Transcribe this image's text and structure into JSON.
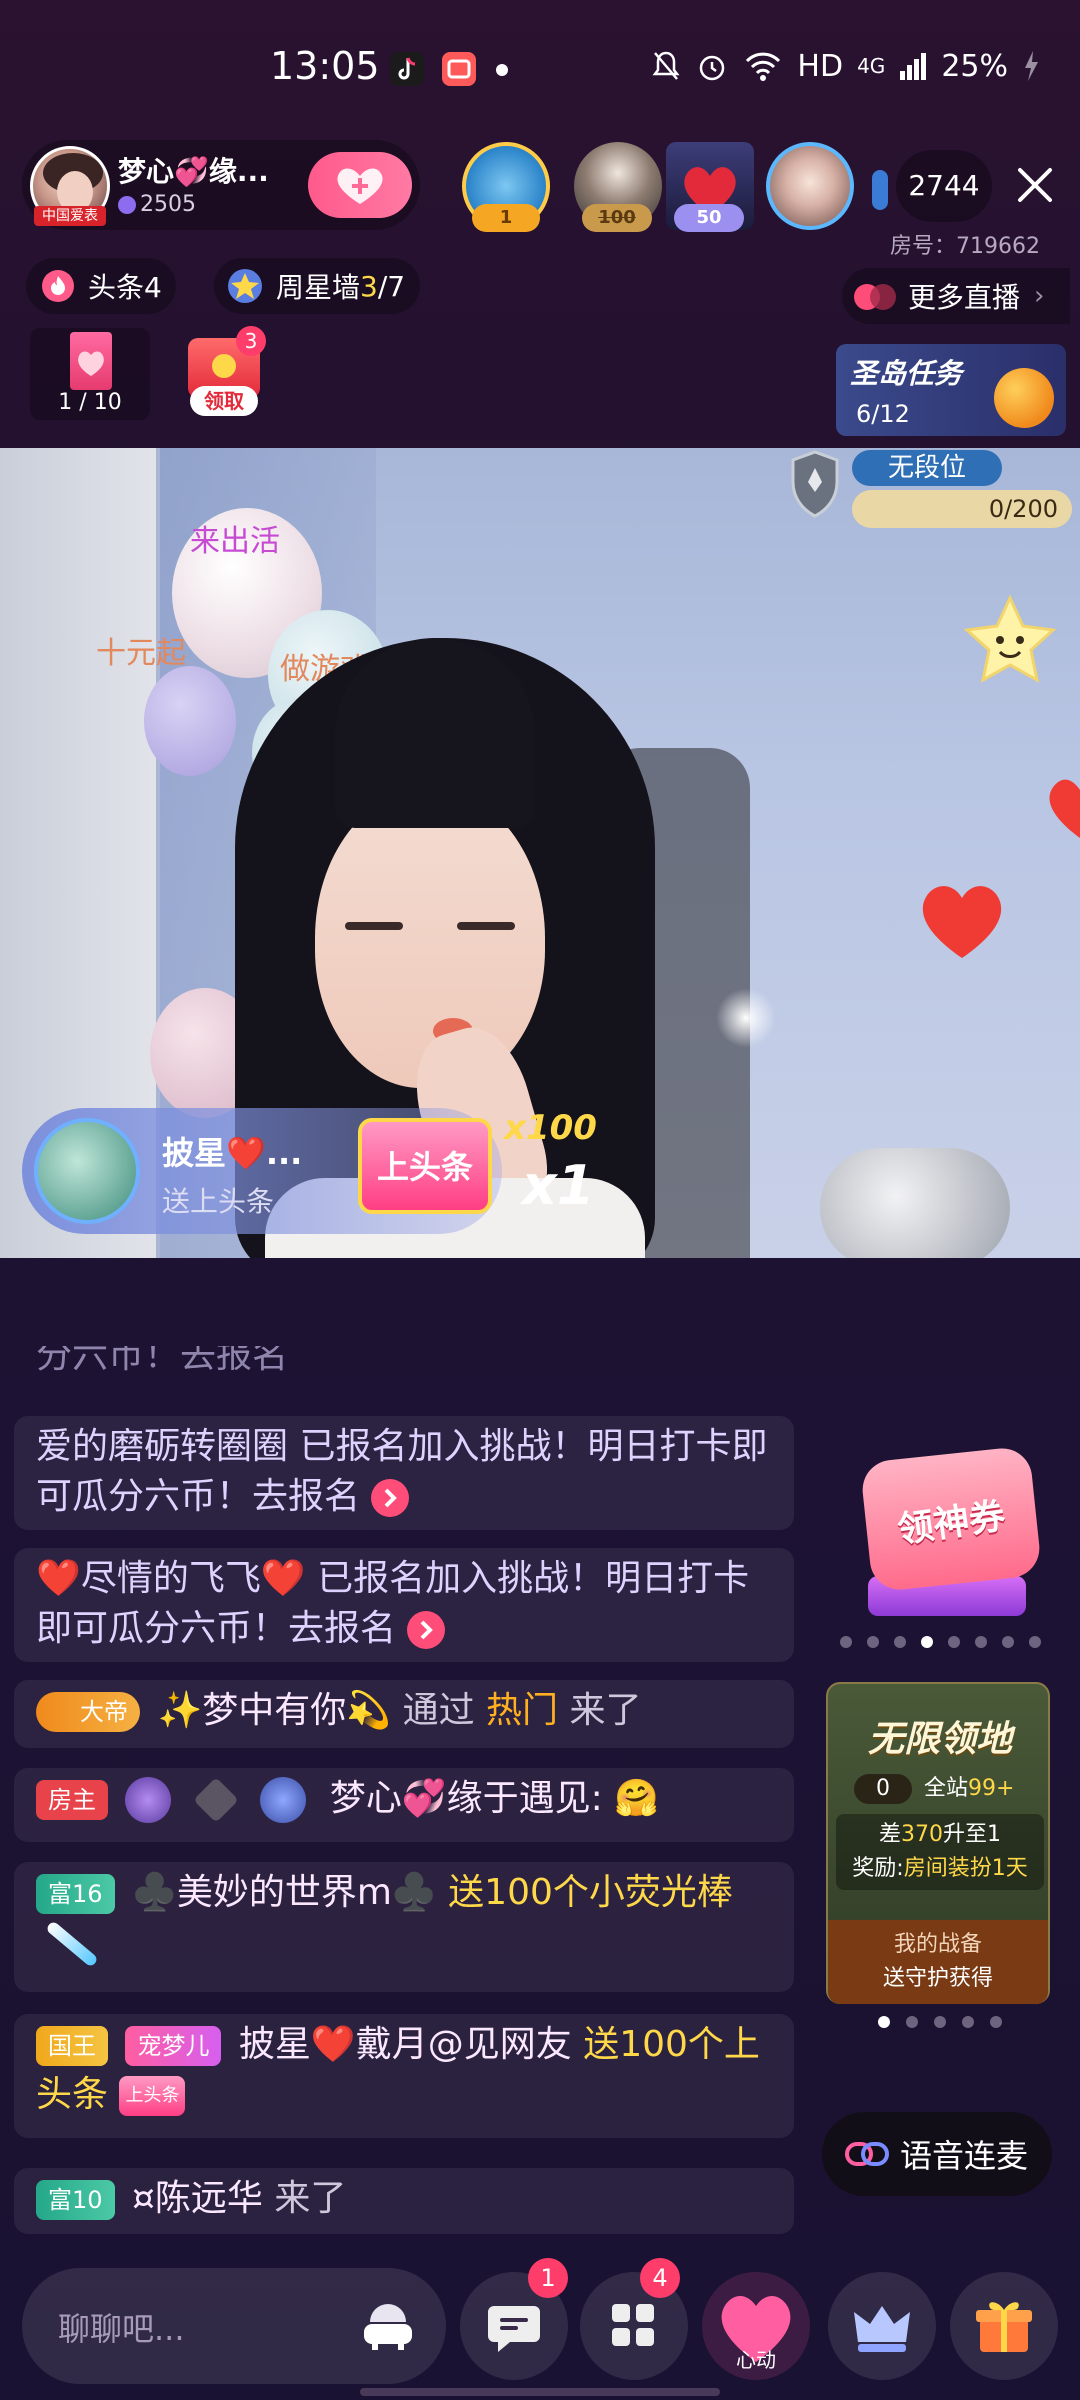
{
  "status": {
    "time": "13:05",
    "network": "HD",
    "signal": "4G",
    "battery": "25%"
  },
  "anchor": {
    "name": "梦心💞缘...",
    "avatar_tag": "中国爱表",
    "count": "2505"
  },
  "viewers": [
    {
      "badge": "1"
    },
    {
      "badge": "100"
    },
    {
      "badge": "50"
    },
    {
      "badge": ""
    }
  ],
  "viewer_count": "2744",
  "room_no": "房号：719662",
  "toutiao_label": "头条4",
  "star_wall": {
    "prefix": "周星墙",
    "current": "3",
    "total": "/7"
  },
  "more_live": "更多直播",
  "card_progress": "1 / 10",
  "redpack": {
    "label": "领取",
    "badge": "3"
  },
  "task": {
    "title": "圣岛任务",
    "progress": "6/12"
  },
  "rank": {
    "title": "无段位",
    "progress": "0/200"
  },
  "balloon_texts": [
    "来出活",
    "十元起",
    "做游戏"
  ],
  "gift_banner": {
    "name": "披星❤️...",
    "sub": "送上头条",
    "gift": "上头条",
    "count": "x100",
    "multiplier": "x1"
  },
  "chat": {
    "partial": "分六币！去报名",
    "rows": [
      {
        "text": "爱的磨砺转圈圈 已报名加入挑战！明日打卡即可瓜分六币！去报名"
      },
      {
        "text": "❤️尽情的飞飞❤️ 已报名加入挑战！明日打卡即可瓜分六币！去报名"
      }
    ],
    "row3": {
      "tag": "大帝",
      "name": "✨梦中有你💫",
      "via": "通过",
      "src": "热门",
      "action": "来了"
    },
    "row4": {
      "tag": "房主",
      "name": "梦心💞缘于遇见:",
      "emoji": "🤗"
    },
    "row5": {
      "tag": "富16",
      "name": "♣️美妙的世界m♣️",
      "gift": "送100个小荧光棒"
    },
    "row6": {
      "tag1": "国王",
      "tag2": "宠梦儿",
      "name": "披星❤️戴月@见网友",
      "gift": "送100个上头条",
      "gift_icon": "上头条"
    },
    "row7": {
      "tag": "富10",
      "name": "¤陈远华",
      "action": "来了"
    }
  },
  "promo": {
    "coupon": "领神券",
    "dots": 8,
    "active_dot": 3
  },
  "land": {
    "title": "无限领地",
    "count": "0",
    "site_prefix": "全站",
    "site_rank": "99+",
    "gap_prefix": "差",
    "gap": "370",
    "gap_suffix": "升至1",
    "reward_prefix": "奖励:",
    "reward": "房间装扮1天",
    "battle_1": "我的战备",
    "battle_2": "送守护获得",
    "dots": 5,
    "active_dot": 0
  },
  "voice_link": "语音连麦",
  "input": {
    "placeholder": "聊聊吧..."
  },
  "bottom": {
    "msg_badge": "1",
    "more_badge": "4",
    "heart_label": "心动"
  },
  "colors": {
    "accent": "#ff4d7a",
    "gold": "#ffd84a"
  }
}
